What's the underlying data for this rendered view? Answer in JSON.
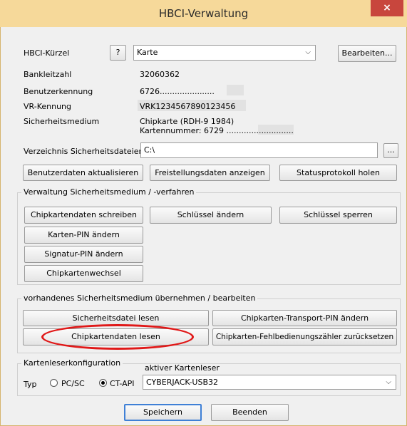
{
  "window": {
    "title": "HBCI-Verwaltung",
    "close_glyph": "×"
  },
  "hbci_kuerzel": {
    "label": "HBCI-Kürzel",
    "help_button": "?",
    "value": "Karte",
    "edit_button": "Bearbeiten..."
  },
  "fields": {
    "bankleitzahl": {
      "label": "Bankleitzahl",
      "value": "32060362"
    },
    "benutzerkennung": {
      "label": "Benutzerkennung",
      "value": "6726......................"
    },
    "vr_kennung": {
      "label": "VR-Kennung",
      "value": "VRK1234567890123456"
    },
    "sicherheitsmedium": {
      "label": "Sicherheitsmedium",
      "line1": "Chipkarte  (RDH-9  1984)",
      "line2": "Kartennummer: 6729 ..........................."
    }
  },
  "verzeichnis": {
    "label": "Verzeichnis Sicherheitsdateien",
    "value": "C:\\",
    "browse_button": "..."
  },
  "actions_row": {
    "benutzerdaten": "Benutzerdaten aktualisieren",
    "freistellung": "Freistellungsdaten anzeigen",
    "statusprotokoll": "Statusprotokoll holen"
  },
  "verwaltung_group": {
    "title": "Verwaltung Sicherheitsmedium / -verfahren",
    "chipkartendaten_schreiben": "Chipkartendaten schreiben",
    "schluessel_aendern": "Schlüssel ändern",
    "schluessel_sperren": "Schlüssel sperren",
    "karten_pin": "Karten-PIN ändern",
    "signatur_pin": "Signatur-PIN ändern",
    "chipkartenwechsel": "Chipkartenwechsel"
  },
  "uebernehmen_group": {
    "title": "vorhandenes Sicherheitsmedium übernehmen / bearbeiten",
    "sicherheitsdatei_lesen": "Sicherheitsdatei lesen",
    "transport_pin": "Chipkarten-Transport-PIN ändern",
    "chipkartendaten_lesen": "Chipkartendaten lesen",
    "fehlbedienung": "Chipkarten-Fehlbedienungszähler zurücksetzen"
  },
  "kartenleser_group": {
    "title": "Kartenleserkonfiguration",
    "typ_label": "Typ",
    "option_pcsc": "PC/SC",
    "option_ctapi": "CT-API",
    "selected": "CT-API",
    "aktiver_label": "aktiver Kartenleser",
    "aktiver_value": "CYBERJACK-USB32"
  },
  "footer": {
    "save": "Speichern",
    "close": "Beenden"
  },
  "colors": {
    "titlebar": "#f6d99a",
    "close": "#c8463d",
    "highlight": "#e01818"
  }
}
